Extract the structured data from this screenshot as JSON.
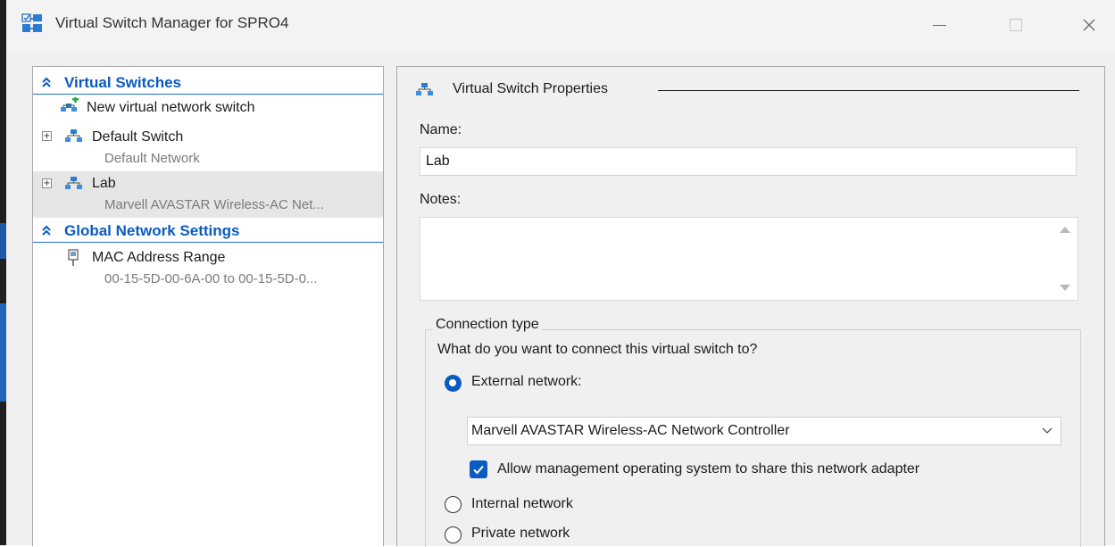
{
  "window": {
    "title": "Virtual Switch Manager for SPRO4",
    "controls": [
      "minimize-icon",
      "maximize-icon",
      "close-icon"
    ]
  },
  "sidebar": {
    "virtual_switches_header": "Virtual Switches",
    "new_switch": "New virtual network switch",
    "items": [
      {
        "label": "Default Switch",
        "sub": "Default Network"
      },
      {
        "label": "Lab",
        "sub": "Marvell AVASTAR Wireless-AC Net..."
      }
    ],
    "global_header": "Global Network Settings",
    "mac": {
      "label": "MAC Address Range",
      "sub": "00-15-5D-00-6A-00 to 00-15-5D-0..."
    }
  },
  "properties": {
    "header": "Virtual Switch Properties",
    "name_label": "Name:",
    "name_value": "Lab",
    "notes_label": "Notes:",
    "notes_value": "",
    "connection": {
      "group_title": "Connection type",
      "question": "What do you want to connect this virtual switch to?",
      "external_label": "External network:",
      "external_selected": true,
      "adapter": "Marvell AVASTAR Wireless-AC Network Controller",
      "allow_mgmt_label": "Allow management operating system to share this network adapter",
      "allow_mgmt_checked": true,
      "internal_label": "Internal network",
      "private_label": "Private network"
    }
  },
  "colors": {
    "accent": "#0a5bbf",
    "selection": "#e6e6e6",
    "background": "#f0f0f0"
  }
}
